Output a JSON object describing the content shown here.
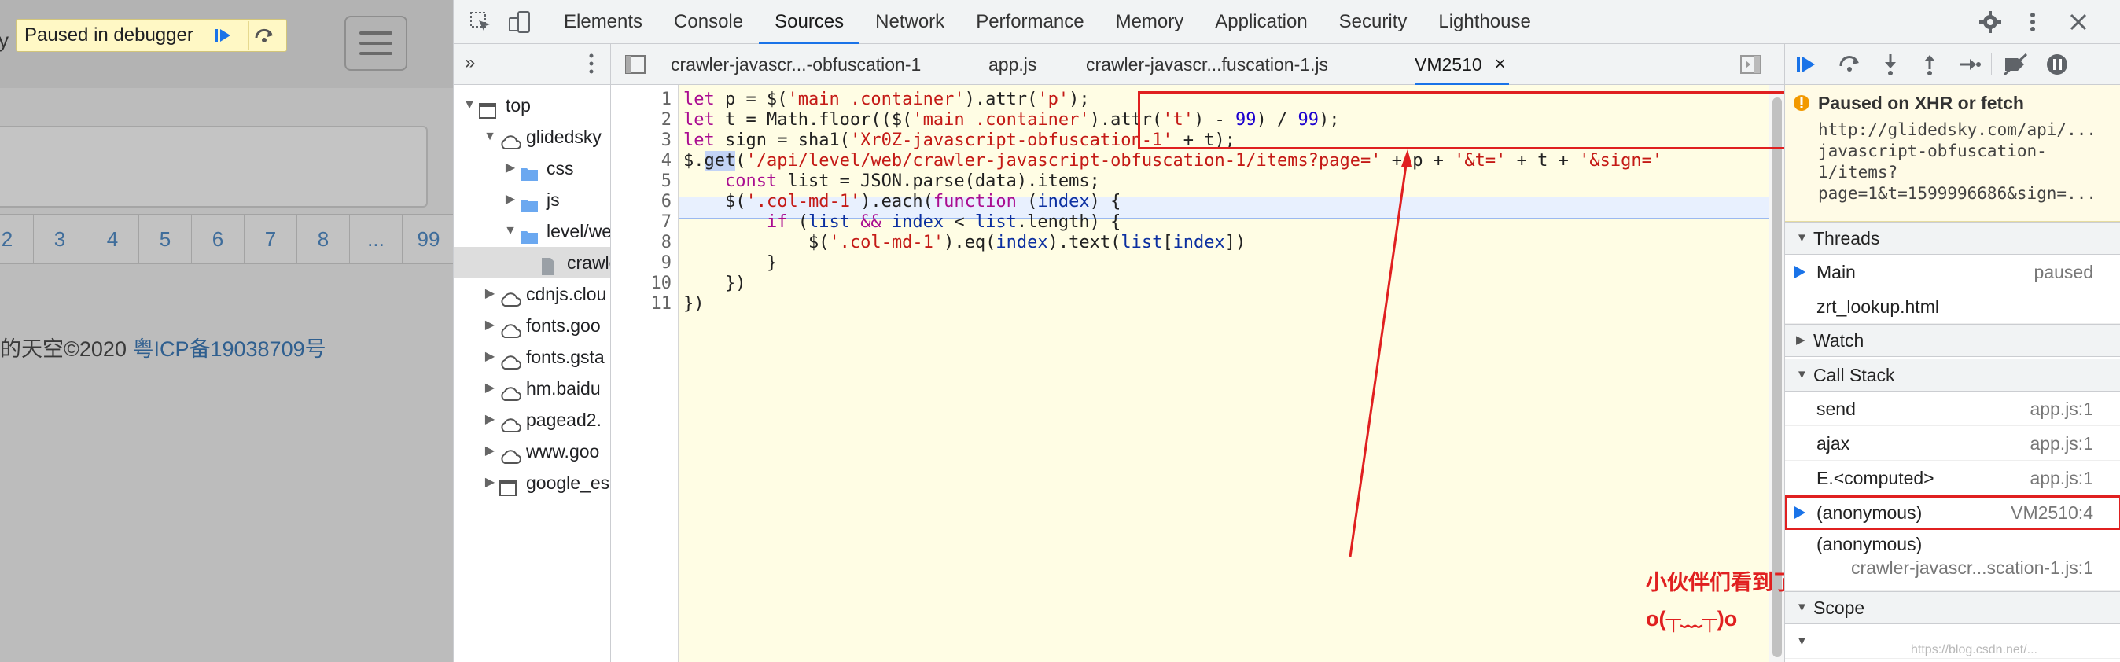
{
  "site": {
    "nav_fragment": "y",
    "paused_label": "Paused in debugger",
    "pager": [
      "2",
      "3",
      "4",
      "5",
      "6",
      "7",
      "8",
      "...",
      "99"
    ],
    "footer_text": "的天空©2020 ",
    "footer_link": "粤ICP备19038709号"
  },
  "devtools": {
    "tabs": [
      "Elements",
      "Console",
      "Sources",
      "Network",
      "Performance",
      "Memory",
      "Application",
      "Security",
      "Lighthouse"
    ],
    "active_tab": "Sources",
    "navigator": {
      "items": [
        {
          "label": "top",
          "icon": "frame-icon",
          "toggle": "▼",
          "depth": 0
        },
        {
          "label": "glidedsky",
          "icon": "cloud-icon",
          "toggle": "▼",
          "depth": 1
        },
        {
          "label": "css",
          "icon": "folder-icon",
          "toggle": "▶",
          "depth": 2
        },
        {
          "label": "js",
          "icon": "folder-icon",
          "toggle": "▶",
          "depth": 2
        },
        {
          "label": "level/web",
          "icon": "folder-icon",
          "toggle": "▼",
          "depth": 2
        },
        {
          "label": "crawler",
          "icon": "file-icon",
          "toggle": "",
          "depth": 3
        },
        {
          "label": "cdnjs.clou",
          "icon": "cloud-icon",
          "toggle": "▶",
          "depth": 1
        },
        {
          "label": "fonts.goo",
          "icon": "cloud-icon",
          "toggle": "▶",
          "depth": 1
        },
        {
          "label": "fonts.gsta",
          "icon": "cloud-icon",
          "toggle": "▶",
          "depth": 1
        },
        {
          "label": "hm.baidu",
          "icon": "cloud-icon",
          "toggle": "▶",
          "depth": 1
        },
        {
          "label": "pagead2.",
          "icon": "cloud-icon",
          "toggle": "▶",
          "depth": 1
        },
        {
          "label": "www.goo",
          "icon": "cloud-icon",
          "toggle": "▶",
          "depth": 1
        },
        {
          "label": "google_es",
          "icon": "frame-icon",
          "toggle": "▶",
          "depth": 1
        }
      ]
    },
    "editor_tabs": [
      {
        "label": "crawler-javascr...-obfuscation-1"
      },
      {
        "label": "app.js"
      },
      {
        "label": "crawler-javascr...fuscation-1.js"
      },
      {
        "label": "VM2510"
      }
    ],
    "active_editor_tab": "VM2510",
    "code_lines": [
      "1",
      "2",
      "3",
      "4",
      "5",
      "6",
      "7",
      "8",
      "9",
      "10",
      "11"
    ],
    "code": {
      "l1": [
        [
          "let ",
          "kw"
        ],
        [
          "p = $(",
          ""
        ],
        [
          "'main .container'",
          "str"
        ],
        [
          ").attr(",
          ""
        ],
        [
          "'p'",
          "str"
        ],
        [
          ");",
          ""
        ]
      ],
      "l2": [
        [
          "let ",
          "kw"
        ],
        [
          "t = Math.floor(($(",
          ""
        ],
        [
          "'main .container'",
          "str"
        ],
        [
          ").attr(",
          ""
        ],
        [
          "'t'",
          "str"
        ],
        [
          ") - ",
          ""
        ],
        [
          "99",
          "num"
        ],
        [
          ") / ",
          ""
        ],
        [
          "99",
          "num"
        ],
        [
          ");",
          ""
        ]
      ],
      "l3": [
        [
          "let ",
          "kw"
        ],
        [
          "sign = sha1(",
          ""
        ],
        [
          "'Xr0Z-javascript-obfuscation-1'",
          "str"
        ],
        [
          " + t);",
          ""
        ]
      ],
      "l4": [
        [
          "$.",
          ""
        ],
        [
          "get",
          "hl"
        ],
        [
          "(",
          ""
        ],
        [
          "'/api/level/web/crawler-javascript-obfuscation-1/items?page='",
          "str"
        ],
        [
          " + p + ",
          ""
        ],
        [
          "'&t='",
          "str"
        ],
        [
          " + t + ",
          ""
        ],
        [
          "'&sign='",
          "str"
        ]
      ],
      "l5": [
        [
          "    const ",
          "kw"
        ],
        [
          "list = JSON.parse(data).items;",
          ""
        ]
      ],
      "l6": [
        [
          "    $(",
          ""
        ],
        [
          "'.col-md-1'",
          "str"
        ],
        [
          ").each(",
          ""
        ],
        [
          "function ",
          "kw"
        ],
        [
          "(",
          ""
        ],
        [
          "index",
          "var"
        ],
        [
          ") {",
          ""
        ]
      ],
      "l7": [
        [
          "        if ",
          "kw"
        ],
        [
          "(",
          ""
        ],
        [
          "list",
          "var"
        ],
        [
          " ",
          ""
        ],
        [
          "&&",
          "kw"
        ],
        [
          " ",
          ""
        ],
        [
          "index",
          "var"
        ],
        [
          " < ",
          ""
        ],
        [
          "list",
          "var"
        ],
        [
          ".length) {",
          ""
        ]
      ],
      "l8": [
        [
          "            $(",
          ""
        ],
        [
          "'.col-md-1'",
          "str"
        ],
        [
          ").eq(",
          ""
        ],
        [
          "index",
          "var"
        ],
        [
          ").text(",
          ""
        ],
        [
          "list",
          "var"
        ],
        [
          "[",
          ""
        ],
        [
          "index",
          "var"
        ],
        [
          "])",
          ""
        ]
      ],
      "l9": [
        [
          "        }",
          ""
        ]
      ],
      "l10": [
        [
          "    })",
          ""
        ]
      ],
      "l11": [
        [
          "})",
          ""
        ]
      ]
    },
    "annotation": {
      "line1": "小伙伴们看到了嘛，胜利的曙光它来了",
      "line2": "o(┬﹏┬)o"
    },
    "sidebar": {
      "paused_title": "Paused on XHR or fetch",
      "paused_url": "http://glidedsky.com/api/...\njavascript-obfuscation-\n1/items?\npage=1&t=1599996686&sign=...",
      "threads_label": "Threads",
      "threads": [
        {
          "name": "Main",
          "status": "paused"
        },
        {
          "name": "zrt_lookup.html",
          "status": ""
        }
      ],
      "watch_label": "Watch",
      "callstack_label": "Call Stack",
      "callstack": [
        {
          "fn": "send",
          "loc": "app.js:1"
        },
        {
          "fn": "ajax",
          "loc": "app.js:1"
        },
        {
          "fn": "E.<computed>",
          "loc": "app.js:1"
        },
        {
          "fn": "(anonymous)",
          "loc": "VM2510:4"
        },
        {
          "fn": "(anonymous)",
          "loc": "crawler-javascr...scation-1.js:1"
        }
      ],
      "scope_label": "Scope"
    },
    "colors": {
      "accent": "#1a73e8",
      "annotation_red": "#e02020",
      "paused_bg": "#fff8c5"
    }
  },
  "watermark": "https://blog.csdn.net/..."
}
